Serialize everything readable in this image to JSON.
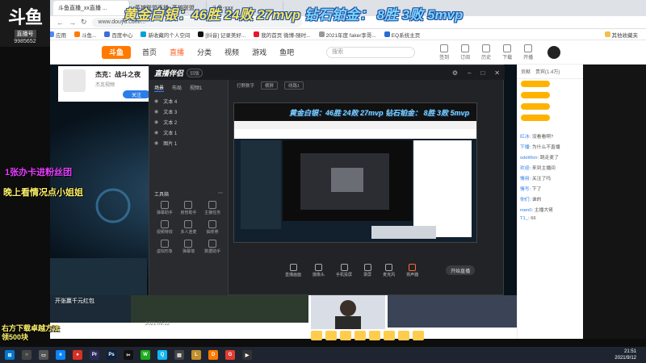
{
  "browser": {
    "tabs": [
      "斗鱼直播_xx直播 ...",
      "英雄联盟直播_英雄联盟...",
      "斗鱼-xxx"
    ],
    "url": "www.douyu.com/...",
    "bookmarks": [
      "应用",
      "斗鱼...",
      "百度中心",
      "新收藏的个人空间",
      "[抖音] 记录美好...",
      "我的首页 微博-随时...",
      "2021年度 faker李哥...",
      "EQ系统主页",
      "其他收藏夹"
    ]
  },
  "douyu_logo": {
    "brand": "斗鱼",
    "tag": "直播号",
    "number": "9985652"
  },
  "title_overlay": {
    "gold": "黄金白银：46胜 24败 27mvp",
    "blue": "钻石铂金： 8胜 3败 5mvp"
  },
  "site_header": {
    "logo": "斗鱼",
    "nav": [
      "首页",
      "直播",
      "分类",
      "视频",
      "游戏",
      "鱼吧"
    ],
    "active_nav": "直播",
    "search_placeholder": "搜索",
    "icons": [
      {
        "icon": "bell-icon",
        "label": "签到"
      },
      {
        "icon": "star-icon",
        "label": "订阅"
      },
      {
        "icon": "history-icon",
        "label": "历史"
      },
      {
        "icon": "download-icon",
        "label": "下载"
      },
      {
        "icon": "live-icon",
        "label": "开播"
      }
    ]
  },
  "streamer": {
    "name": "杰克：战斗之夜",
    "status": "杰克视频",
    "follow": "关注"
  },
  "left_overlays": {
    "line1": "1张办卡进粉丝团",
    "line2": "晚上看情况点小姐姐",
    "line3a": "右方下载卓越方法",
    "line3b": "领500块"
  },
  "assistant": {
    "app_name": "直播伴侣",
    "version": "旧版",
    "tabs": [
      "场景",
      "布局",
      "视频1"
    ],
    "scenes": [
      "文本 4",
      "文本 3",
      "文本 2",
      "文本 1",
      "图片 1"
    ],
    "tools_title": "工具箱",
    "tools": [
      "弹幕助手",
      "房管助手",
      "主播任务",
      "视频特效",
      "多人连麦",
      "抽奖券",
      "虚拟形象",
      "弹幕墙",
      "数据助手"
    ],
    "topbar": [
      "打野数字",
      "横屏",
      "线路1"
    ],
    "preview_title": "黄金白银：46胜 24败 27mvp 钻石铂金： 8胜 3败 5mvp",
    "bottom_tools": [
      "直播画面",
      "摄像头",
      "手机投屏",
      "录屏",
      "麦克风",
      "扬声器"
    ],
    "start_label": "开始直播"
  },
  "chat": {
    "tabs": [
      "贡献",
      "贵宾(1.4万)"
    ],
    "lines": [
      {
        "user": "红冰",
        "text": "没看看啊?"
      },
      {
        "user": "下播",
        "text": "为什么不直播"
      },
      {
        "user": "odeWon",
        "text": "跳走麦了"
      },
      {
        "user": "欢迎",
        "text": "来到主播间"
      },
      {
        "user": "情用",
        "text": "关注了吗"
      },
      {
        "user": "情写",
        "text": "下了"
      },
      {
        "user": "你们",
        "text": "谁的"
      },
      {
        "user": "men0",
        "text": "主播大佬"
      },
      {
        "user": "T1_",
        "text": "66"
      }
    ]
  },
  "bottom": {
    "gift_label": "开张赢千元红包",
    "date": "2021.09.12"
  },
  "taskbar": {
    "time": "21:51",
    "date": "2021/9/12"
  }
}
